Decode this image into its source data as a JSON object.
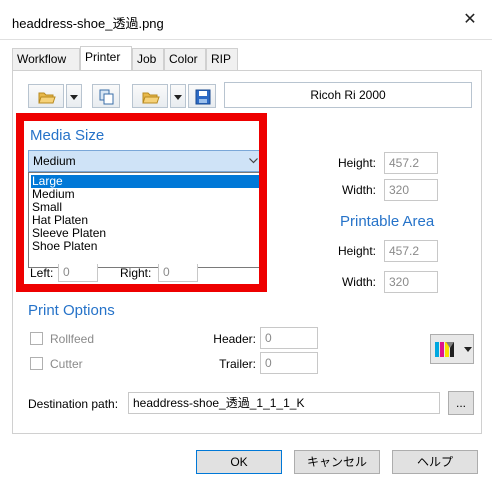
{
  "window": {
    "title": "headdress-shoe_透過.png",
    "close_glyph": "✕"
  },
  "tabs": [
    {
      "label": "Workflow"
    },
    {
      "label": "Printer"
    },
    {
      "label": "Job"
    },
    {
      "label": "Color"
    },
    {
      "label": "RIP"
    }
  ],
  "active_tab": "Printer",
  "toolbar": {
    "icons": [
      "folder-open-icon",
      "dropdown-arrow-icon",
      "copy-icon",
      "folder-open-icon",
      "dropdown-arrow-icon",
      "save-icon"
    ]
  },
  "printer": {
    "name": "Ricoh Ri 2000"
  },
  "media_size": {
    "heading": "Media Size",
    "selected": "Medium",
    "options": [
      "Large",
      "Medium",
      "Small",
      "Hat Platen",
      "Sleeve Platen",
      "Shoe Platen"
    ],
    "highlighted": "Large",
    "height_label": "Height:",
    "height_value": "457.2",
    "width_label": "Width:",
    "width_value": "320",
    "left_label": "Left:",
    "left_value": "0",
    "right_label": "Right:",
    "right_value": "0"
  },
  "printable_area": {
    "heading": "Printable Area",
    "height_label": "Height:",
    "height_value": "457.2",
    "width_label": "Width:",
    "width_value": "320"
  },
  "print_options": {
    "heading": "Print Options",
    "rollfeed_label": "Rollfeed",
    "rollfeed_checked": false,
    "cutter_label": "Cutter",
    "cutter_checked": false,
    "header_label": "Header:",
    "header_value": "0",
    "trailer_label": "Trailer:",
    "trailer_value": "0"
  },
  "destination": {
    "label": "Destination path:",
    "value": "headdress-shoe_透過_1_1_1_K",
    "browse_label": "..."
  },
  "buttons": {
    "ok": "OK",
    "cancel": "キャンセル",
    "help": "ヘルプ"
  },
  "colors": {
    "accent": "#2673c9",
    "highlight_frame": "#ee0000",
    "selection": "#0078d7"
  }
}
